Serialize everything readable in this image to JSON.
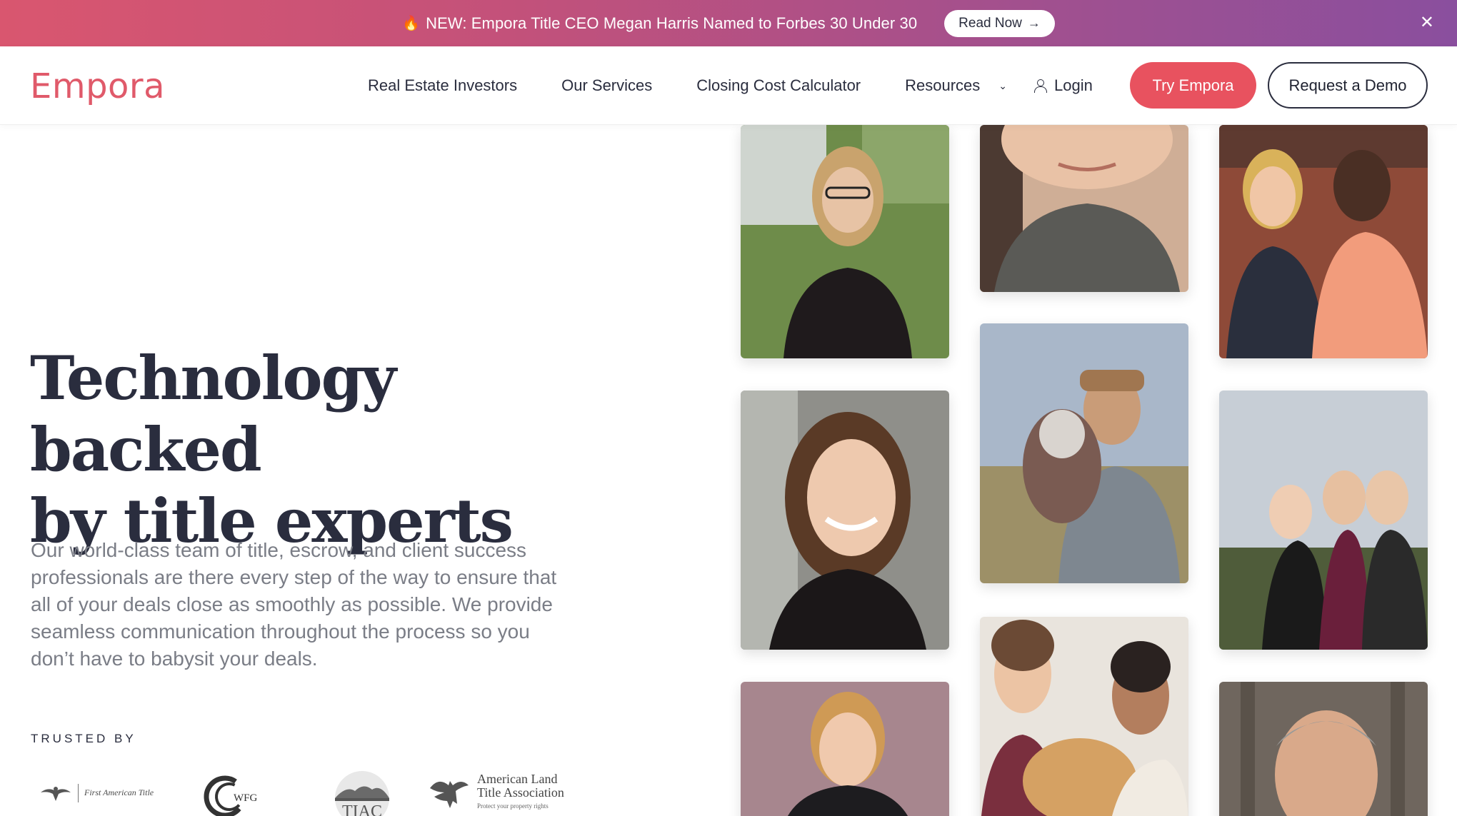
{
  "banner": {
    "icon": "flame-icon",
    "text": "NEW: Empora Title CEO Megan Harris Named to Forbes 30 Under 30",
    "cta_label": "Read Now",
    "colors": [
      "#d9566f",
      "#8a4f9e"
    ]
  },
  "nav": {
    "logo": "Empora",
    "links": [
      "Real Estate Investors",
      "Our Services",
      "Closing Cost Calculator",
      "Resources"
    ],
    "login_label": "Login",
    "try_label": "Try Empora",
    "demo_label": "Request a Demo",
    "accent": "#e8525f"
  },
  "hero": {
    "headline_line1": "Technology backed",
    "headline_line2": "by title experts",
    "body": "Our world-class team of title, escrow, and client success professionals are there every step of the way to ensure that all of your deals close as smoothly as possible. We provide seamless communication throughout the process so you don’t have to babysit your deals."
  },
  "trusted": {
    "label": "TRUSTED BY",
    "logos": [
      {
        "name": "First American Title",
        "text": "First American Title"
      },
      {
        "name": "WFG",
        "text": "WFG"
      },
      {
        "name": "TIAC",
        "text": "TIAC"
      },
      {
        "name": "American Land Title Association",
        "line1": "American Land",
        "line2": "Title Association",
        "tagline": "Protect your property rights"
      }
    ]
  }
}
